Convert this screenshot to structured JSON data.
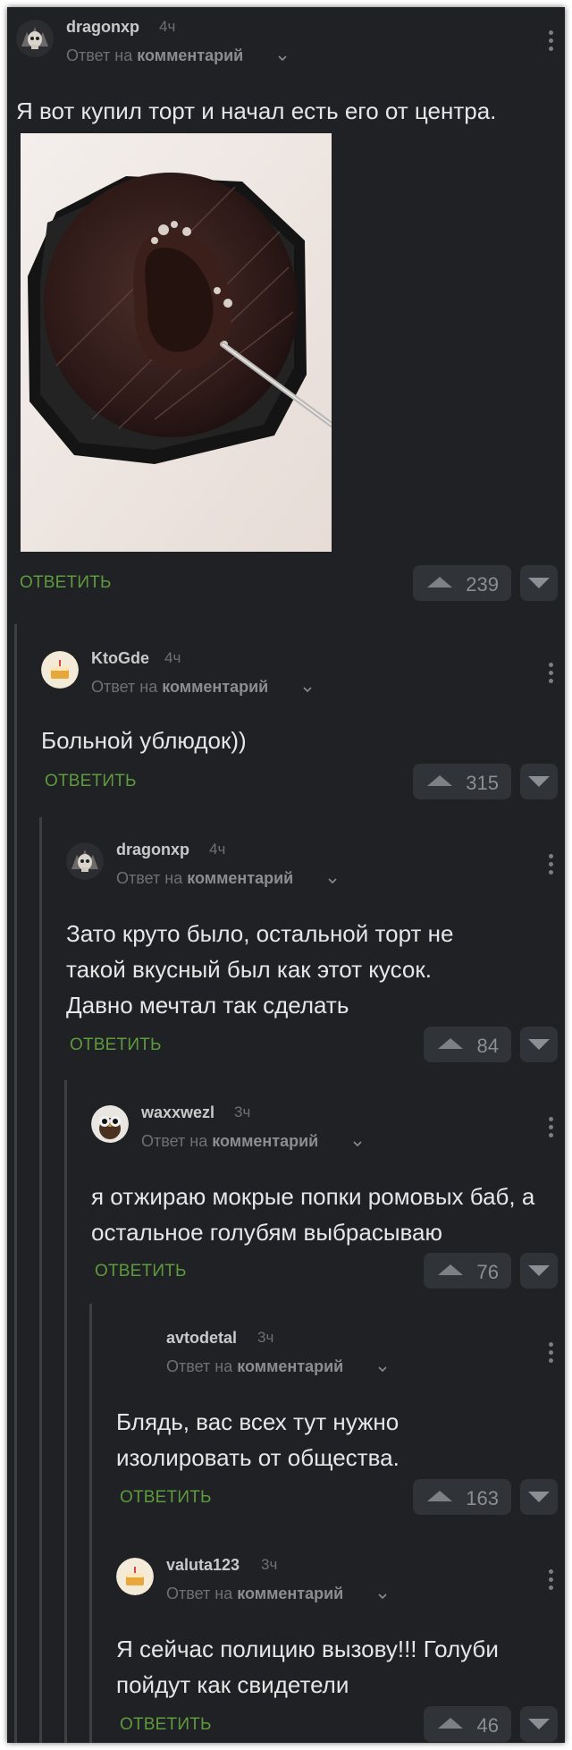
{
  "reply_label": "ОТВЕТИТЬ",
  "comments": [
    {
      "username": "dragonxp",
      "time": "4ч",
      "reply_prefix": "Ответ на",
      "reply_target": "комментарий",
      "text": "Я вот купил торт и начал есть его от центра.",
      "votes": "239",
      "avatar": "skull-avatar",
      "has_image": true
    },
    {
      "username": "KtoGde",
      "time": "4ч",
      "reply_prefix": "Ответ на",
      "reply_target": "комментарий",
      "text": "Больной ублюдок))",
      "votes": "315",
      "avatar": "cake-avatar"
    },
    {
      "username": "dragonxp",
      "time": "4ч",
      "reply_prefix": "Ответ на",
      "reply_target": "комментарий",
      "text": "Зато круто было, остальной торт не такой вкусный был как этот кусок. Давно мечтал так сделать",
      "votes": "84",
      "avatar": "skull-avatar"
    },
    {
      "username": "waxxwezl",
      "time": "3ч",
      "reply_prefix": "Ответ на",
      "reply_target": "комментарий",
      "text": "я отжираю мокрые попки ромовых баб, а остальное голубям выбрасываю",
      "votes": "76",
      "avatar": "owl-avatar"
    },
    {
      "username": "avtodetal",
      "time": "3ч",
      "reply_prefix": "Ответ на",
      "reply_target": "комментарий",
      "text": "Блядь, вас всех тут нужно изолировать от общества.",
      "votes": "163",
      "avatar": "blank-avatar"
    },
    {
      "username": "valuta123",
      "time": "3ч",
      "reply_prefix": "Ответ на",
      "reply_target": "комментарий",
      "text": "Я сейчас полицию вызову!!! Голуби пойдут как свидетели",
      "votes": "46",
      "avatar": "cake-avatar"
    }
  ],
  "colors": {
    "background": "#1f2124",
    "accent_green": "#5d9b3d",
    "text": "#e6e6e6",
    "muted": "#6d7075"
  }
}
